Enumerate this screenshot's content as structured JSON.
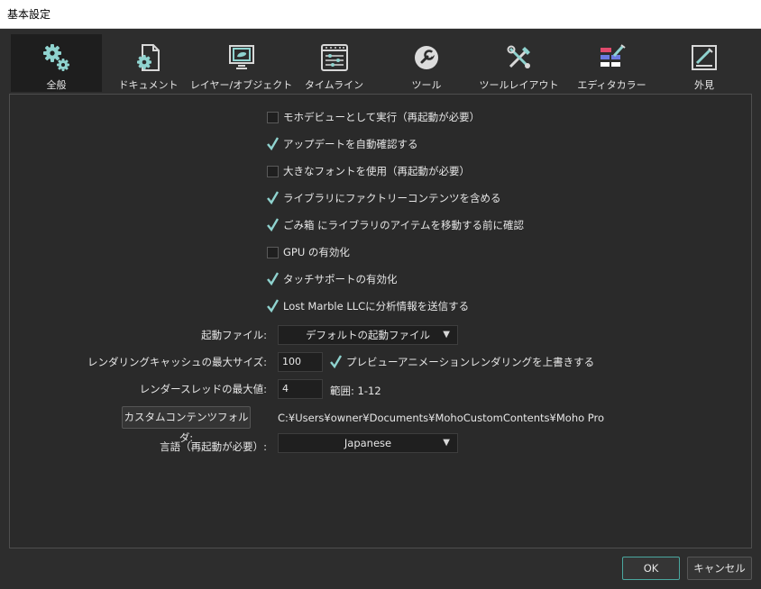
{
  "window": {
    "title": "基本設定"
  },
  "tabs": [
    {
      "label": "全般",
      "icon": "gears-icon"
    },
    {
      "label": "ドキュメント",
      "icon": "document-gear-icon"
    },
    {
      "label": "レイヤー/オブジェクト",
      "icon": "layer-object-icon"
    },
    {
      "label": "タイムライン",
      "icon": "timeline-icon"
    },
    {
      "label": "ツール",
      "icon": "wrench-icon"
    },
    {
      "label": "ツールレイアウト",
      "icon": "tools-layout-icon"
    },
    {
      "label": "エディタカラー",
      "icon": "editor-colors-icon"
    },
    {
      "label": "外見",
      "icon": "appearance-icon"
    }
  ],
  "options": [
    {
      "label": "モホデビューとして実行（再起動が必要）",
      "checked": false
    },
    {
      "label": "アップデートを自動確認する",
      "checked": true
    },
    {
      "label": "大きなフォントを使用（再起動が必要）",
      "checked": false
    },
    {
      "label": "ライブラリにファクトリーコンテンツを含める",
      "checked": true
    },
    {
      "label": "ごみ箱 にライブラリのアイテムを移動する前に確認",
      "checked": true
    },
    {
      "label": "GPU の有効化",
      "checked": false
    },
    {
      "label": "タッチサポートの有効化",
      "checked": true
    },
    {
      "label": "Lost Marble LLCに分析情報を送信する",
      "checked": true
    }
  ],
  "startup_file": {
    "label": "起動ファイル:",
    "value": "デフォルトの起動ファイル"
  },
  "render_cache": {
    "label": "レンダリングキャッシュの最大サイズ:",
    "value": "100",
    "override_label": "プレビューアニメーションレンダリングを上書きする",
    "override_checked": true
  },
  "render_threads": {
    "label": "レンダースレッドの最大値:",
    "value": "4",
    "range": "範囲: 1-12"
  },
  "custom_content": {
    "button": "カスタムコンテンツフォルダ:",
    "path": "C:¥Users¥owner¥Documents¥MohoCustomContents¥Moho Pro"
  },
  "language": {
    "label": "言語（再起動が必要）:",
    "value": "Japanese"
  },
  "footer": {
    "ok": "OK",
    "cancel": "キャンセル"
  },
  "colors": {
    "accent": "#4aa79f",
    "icon_teal": "#8fd3cf"
  }
}
